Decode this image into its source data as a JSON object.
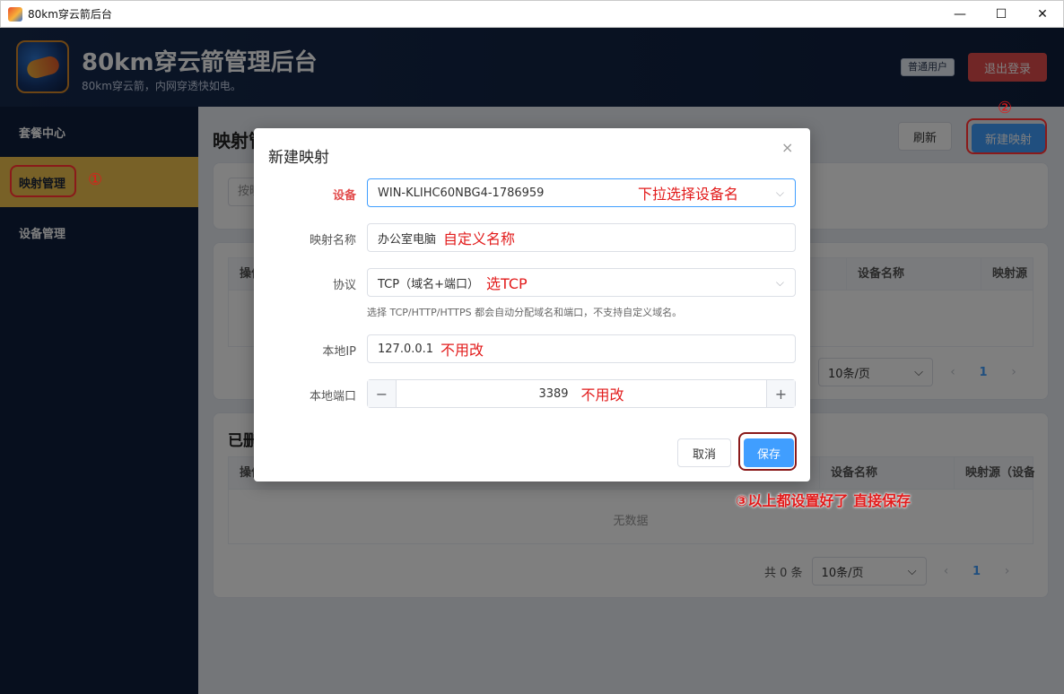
{
  "window": {
    "title": "80km穿云箭后台",
    "minimize": "—",
    "maximize": "☐",
    "close": "✕"
  },
  "header": {
    "brand": "80km穿云箭管理后台",
    "subtitle": "80km穿云箭，内网穿透快如电。",
    "user_role": "普通用户",
    "logout": "退出登录"
  },
  "sidebar": {
    "items": [
      {
        "label": "套餐中心"
      },
      {
        "label": "映射管理"
      },
      {
        "label": "设备管理"
      }
    ]
  },
  "annotations": {
    "step1": "①",
    "step2": "②",
    "step3": "③以上都设置好了 直接保存"
  },
  "main": {
    "title": "映射管理",
    "refresh": "刷新",
    "new_mapping": "新建映射",
    "search_placeholder": "按映",
    "table1": {
      "headers": [
        "操作",
        "设备名称",
        "映射源"
      ]
    },
    "pager1": {
      "size": "10条/页",
      "page": "1"
    },
    "deleted_title": "已删",
    "table2": {
      "headers": [
        "操作",
        "设备名称",
        "映射源（设备"
      ],
      "empty": "无数据"
    },
    "pager2": {
      "total": "共 0 条",
      "size": "10条/页",
      "page": "1"
    }
  },
  "dialog": {
    "title": "新建映射",
    "close": "×",
    "device_label": "设备",
    "device_value": "WIN-KLIHC60NBG4-1786959",
    "device_note": "下拉选择设备名",
    "name_label": "映射名称",
    "name_value": "办公室电脑",
    "name_note": "自定义名称",
    "protocol_label": "协议",
    "protocol_value": "TCP（域名+端口）",
    "protocol_note": "选TCP",
    "protocol_hint": "选择 TCP/HTTP/HTTPS 都会自动分配域名和端口，不支持自定义域名。",
    "ip_label": "本地IP",
    "ip_value": "127.0.0.1",
    "ip_note": "不用改",
    "port_label": "本地端口",
    "port_value": "3389",
    "port_note": "不用改",
    "minus": "−",
    "plus": "+",
    "cancel": "取消",
    "save": "保存"
  },
  "colors": {
    "primary": "#409eff",
    "danger": "#e24c4c",
    "sidebar_active": "#f0c24f",
    "annotation": "#e21b1b"
  }
}
